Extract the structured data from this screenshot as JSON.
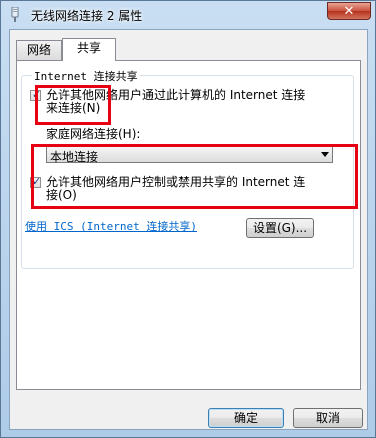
{
  "window": {
    "title": "无线网络连接 2 属性",
    "close_label": "✕"
  },
  "tabs": [
    {
      "label": "网络"
    },
    {
      "label": "共享"
    }
  ],
  "sharing": {
    "group_title": "Internet 连接共享",
    "allow_connect": {
      "checked": true,
      "label_line1": "允许其他网络用户通过此计算机的 Internet 连接",
      "label_line2": "来连接(N)"
    },
    "home_network_label": "家庭网络连接(H):",
    "home_network_value": "本地连接",
    "allow_control": {
      "checked": true,
      "label_line1": "允许其他网络用户控制或禁用共享的 Internet 连",
      "label_line2": "接(O)"
    },
    "ics_link": "使用 ICS (Internet 连接共享)",
    "settings_button": "设置(G)..."
  },
  "footer": {
    "ok_button": "确定",
    "cancel_button": "取消"
  },
  "colors": {
    "highlight_box": "#e60012",
    "link": "#0066cc"
  }
}
